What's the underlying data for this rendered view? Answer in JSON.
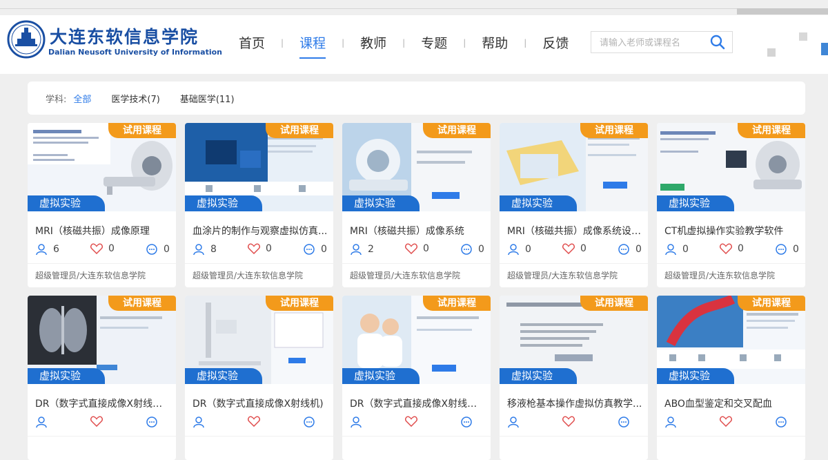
{
  "brand": {
    "name_cn": "大连东软信息学院",
    "name_en": "Dalian Neusoft University of Information"
  },
  "nav": [
    "首页",
    "课程",
    "教师",
    "专题",
    "帮助",
    "反馈"
  ],
  "nav_active": 1,
  "search": {
    "placeholder": "请输入老师或课程名"
  },
  "filter": {
    "label": "学科:",
    "options": [
      "全部",
      "医学技术(7)",
      "基础医学(11)"
    ],
    "active": 0
  },
  "colors": {
    "accent": "#2e7be8",
    "trial_badge": "#f39a1b",
    "virtual_badge": "#1f6fd0",
    "like": "#e04d4d"
  },
  "courses": [
    {
      "badge": "试用课程",
      "type": "虚拟实验",
      "title": "MRI（核磁共振）成像原理",
      "learners": "6",
      "likes": "0",
      "comments": "0",
      "author": "超级管理员/大连东软信息学院"
    },
    {
      "badge": "试用课程",
      "type": "虚拟实验",
      "title": "血涂片的制作与观察虚拟仿真...",
      "learners": "8",
      "likes": "0",
      "comments": "0",
      "author": "超级管理员/大连东软信息学院"
    },
    {
      "badge": "试用课程",
      "type": "虚拟实验",
      "title": "MRI（核磁共振）成像系统",
      "learners": "2",
      "likes": "0",
      "comments": "0",
      "author": "超级管理员/大连东软信息学院"
    },
    {
      "badge": "试用课程",
      "type": "虚拟实验",
      "title": "MRI（核磁共振）成像系统设备...",
      "learners": "0",
      "likes": "0",
      "comments": "0",
      "author": "超级管理员/大连东软信息学院"
    },
    {
      "badge": "试用课程",
      "type": "虚拟实验",
      "title": "CT机虚拟操作实验教学软件",
      "learners": "0",
      "likes": "0",
      "comments": "0",
      "author": "超级管理员/大连东软信息学院"
    },
    {
      "badge": "试用课程",
      "type": "虚拟实验",
      "title": "DR（数字式直接成像X射线机...",
      "learners": "",
      "likes": "",
      "comments": "",
      "author": ""
    },
    {
      "badge": "试用课程",
      "type": "虚拟实验",
      "title": "DR（数字式直接成像X射线机)",
      "learners": "",
      "likes": "",
      "comments": "",
      "author": ""
    },
    {
      "badge": "试用课程",
      "type": "虚拟实验",
      "title": "DR（数字式直接成像X射线机...",
      "learners": "",
      "likes": "",
      "comments": "",
      "author": ""
    },
    {
      "badge": "试用课程",
      "type": "虚拟实验",
      "title": "移液枪基本操作虚拟仿真教学...",
      "learners": "",
      "likes": "",
      "comments": "",
      "author": ""
    },
    {
      "badge": "试用课程",
      "type": "虚拟实验",
      "title": "ABO血型鉴定和交叉配血",
      "learners": "",
      "likes": "",
      "comments": "",
      "author": ""
    }
  ]
}
